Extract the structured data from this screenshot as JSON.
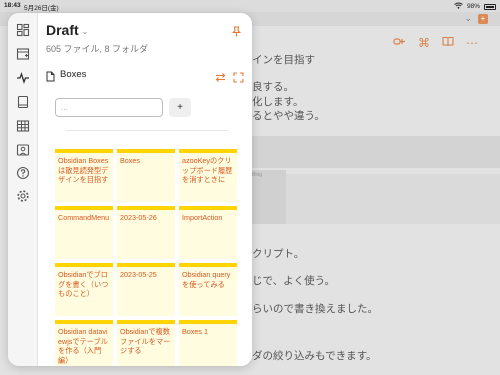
{
  "status_bar": {
    "time": "18:43",
    "date": "5月26日(金)",
    "battery": "98%"
  },
  "background": {
    "text_lines": [
      "インを目指す",
      "良する。",
      "化します。",
      "るとやや違う。",
      "クリプト。",
      "じで、よく使う。",
      "らいので書き換えました。",
      "ダの絞り込みもできます。"
    ],
    "thumb_label": "Blog"
  },
  "panel": {
    "vault_name": "Draft",
    "summary": "605 ファイル, 8 フォルダ",
    "view_name": "Boxes",
    "search_placeholder": "...",
    "add_label": "+",
    "cards": [
      "Obsidian Boxesは散見読発型デザインを目指す",
      "Boxes",
      "azooKeyのクリップボード履歴を消すときに",
      "CommandMenu",
      "2023-05-26",
      "ImportAction",
      "Obsidianでブログを書く（いつものこと）",
      "2023-05-25",
      "Obsidian queryを使ってみる",
      "Obsidian dataviewjsでテーブルを作る（入門編）",
      "Obsidianで複数ファイルをマージする",
      "Boxes 1"
    ]
  },
  "rail_icons": [
    "dashboard-icon",
    "new-note-icon",
    "activity-icon",
    "book-icon",
    "table-icon",
    "image-icon",
    "help-icon",
    "settings-icon"
  ],
  "colors": {
    "accent": "#e8782f",
    "card_bg": "#fffce0",
    "card_border": "#ffd400",
    "card_text": "#d9581e"
  }
}
